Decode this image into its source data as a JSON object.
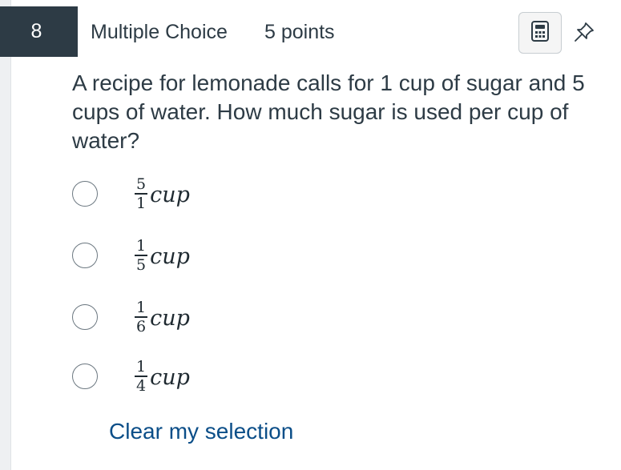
{
  "question": {
    "number": "8",
    "type_label": "Multiple Choice",
    "points_label": "5 points",
    "text": "A recipe for lemonade calls for 1 cup of sugar and 5 cups of water. How much sugar is used per cup of water?"
  },
  "toolbar": {
    "calculator_icon": "calculator-icon",
    "pin_icon": "pin-icon"
  },
  "answers": [
    {
      "numerator": "5",
      "denominator": "1",
      "unit": "cup"
    },
    {
      "numerator": "1",
      "denominator": "5",
      "unit": "cup"
    },
    {
      "numerator": "1",
      "denominator": "6",
      "unit": "cup"
    },
    {
      "numerator": "1",
      "denominator": "4",
      "unit": "cup"
    }
  ],
  "clear_selection_label": "Clear my selection",
  "colors": {
    "header_bg": "#2d3b45",
    "text": "#2d3b45",
    "link": "#0b4e88"
  }
}
